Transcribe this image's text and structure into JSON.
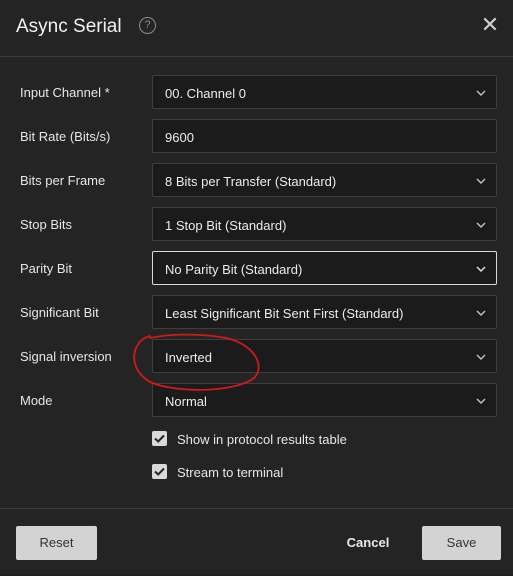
{
  "dialog": {
    "title": "Async Serial",
    "help_icon": "?",
    "close_icon": "✕"
  },
  "fields": [
    {
      "label": "Input Channel *",
      "value": "00.  Channel 0",
      "type": "select"
    },
    {
      "label": "Bit Rate (Bits/s)",
      "value": "9600",
      "type": "input"
    },
    {
      "label": "Bits per Frame",
      "value": "8 Bits per Transfer (Standard)",
      "type": "select"
    },
    {
      "label": "Stop Bits",
      "value": "1 Stop Bit (Standard)",
      "type": "select"
    },
    {
      "label": "Parity Bit",
      "value": "No Parity Bit (Standard)",
      "type": "select"
    },
    {
      "label": "Significant Bit",
      "value": "Least Significant Bit Sent First (Standard)",
      "type": "select"
    },
    {
      "label": "Signal inversion",
      "value": "Inverted",
      "type": "select"
    },
    {
      "label": "Mode",
      "value": "Normal",
      "type": "select"
    }
  ],
  "checkboxes": [
    {
      "label": "Show in protocol results table",
      "checked": true
    },
    {
      "label": "Stream to terminal",
      "checked": true
    }
  ],
  "footer": {
    "reset_label": "Reset",
    "cancel_label": "Cancel",
    "save_label": "Save"
  },
  "colors": {
    "background": "#242424",
    "field_background": "#1b1b1b",
    "annotation": "#d01a1a"
  }
}
